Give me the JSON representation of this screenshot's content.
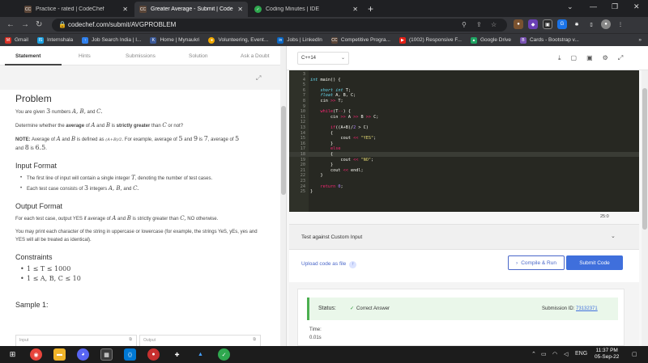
{
  "browser": {
    "tabs": [
      {
        "title": "Practice - rated | CodeChef",
        "icon": "codechef-icon",
        "color": "#5b4638"
      },
      {
        "title": "Greater Average - Submit | Code",
        "icon": "codechef-icon",
        "color": "#5b4638"
      },
      {
        "title": "Coding Minutes | IDE",
        "icon": "coding-minutes-icon",
        "color": "#2fa84f"
      }
    ],
    "url": "codechef.com/submit/AVGPROBLEM",
    "bookmarks": [
      "Gmail",
      "Internshala",
      "Job Search India | I...",
      "Home | Mynaukri",
      "Volunteering, Event...",
      "Jobs | LinkedIn",
      "Competitive Progra...",
      "(1002) Responsive F...",
      "Google Drive",
      "Cards - Bootstrap v..."
    ]
  },
  "problem_tabs": [
    "Statement",
    "Hints",
    "Submissions",
    "Solution",
    "Ask a Doubt"
  ],
  "problem": {
    "title": "Problem",
    "intro_a": "You are given ",
    "intro_math": "3",
    "intro_b": " numbers ",
    "intro_vars": "A, B,",
    "intro_c": " and ",
    "intro_cvar": "C.",
    "q_a": "Determine whether the ",
    "q_avg": "average",
    "q_b": " of ",
    "q_A": "A",
    "q_c": " and ",
    "q_B": "B",
    "q_d": " is ",
    "q_sg": "strictly greater",
    "q_e": " than ",
    "q_C": "C",
    "q_f": " or not?",
    "note_label": "NOTE:",
    "note_a": " Average of ",
    "note_A": "A",
    "note_b": " and ",
    "note_B": "B",
    "note_c": " is defined as ",
    "note_frac": "(A+B)/2",
    "note_d": ". For example, average of ",
    "note_5": "5",
    "note_e": " and ",
    "note_9": "9",
    "note_f": " is ",
    "note_7": "7",
    "note_g": ", average of ",
    "note_5b": "5",
    "note_h": "and ",
    "note_8": "8",
    "note_i": " is ",
    "note_65": "6.5",
    "note_j": ".",
    "input_heading": "Input Format",
    "input_1a": "The first line of input will contain a single integer ",
    "input_1T": "T",
    "input_1b": ", denoting the number of test cases.",
    "input_2a": "Each test case consists of ",
    "input_2n": "3",
    "input_2b": " integers ",
    "input_2v": "A, B,",
    "input_2c": " and ",
    "input_2C": "C.",
    "output_heading": "Output Format",
    "output_1a": "For each test case, output YES if average of ",
    "output_1A": "A",
    "output_1b": " and ",
    "output_1B": "B",
    "output_1c": " is strictly greater than ",
    "output_1C": "C,",
    "output_1d": " NO otherwise.",
    "output_2": "You may print each character of the string in uppercase or lowercase (for example, the strings YeS, yEs, yes and YES will all be treated as identical).",
    "constraints_heading": "Constraints",
    "constraints": [
      "1 ≤ T ≤ 1000",
      "1 ≤ A, B, C ≤ 10"
    ],
    "sample_heading": "Sample 1:",
    "sample_input": "Input",
    "sample_output": "Output"
  },
  "editor": {
    "language": "C++14",
    "lines": [
      {
        "n": "3",
        "t": ""
      },
      {
        "n": "4",
        "t": "int main() {"
      },
      {
        "n": "5",
        "t": ""
      },
      {
        "n": "6",
        "t": "    short int T;"
      },
      {
        "n": "7",
        "t": "    float A, B, C;"
      },
      {
        "n": "8",
        "t": "    cin >> T;"
      },
      {
        "n": "9",
        "t": ""
      },
      {
        "n": "10",
        "t": "    while(T--) {"
      },
      {
        "n": "11",
        "t": "        cin >> A >> B >> C;"
      },
      {
        "n": "12",
        "t": ""
      },
      {
        "n": "13",
        "t": "        if((A+B)/2 > C)"
      },
      {
        "n": "14",
        "t": "        {"
      },
      {
        "n": "15",
        "t": "            cout << \"YES\";"
      },
      {
        "n": "16",
        "t": "        }"
      },
      {
        "n": "17",
        "t": "        else"
      },
      {
        "n": "18",
        "t": "        {"
      },
      {
        "n": "19",
        "t": "            cout << \"NO\";"
      },
      {
        "n": "20",
        "t": "        }"
      },
      {
        "n": "21",
        "t": "        cout << endl;"
      },
      {
        "n": "22",
        "t": "    }"
      },
      {
        "n": "23",
        "t": ""
      },
      {
        "n": "24",
        "t": "    return 0;"
      },
      {
        "n": "25",
        "t": "}"
      }
    ],
    "char_count": "25:0"
  },
  "custom_input_label": "Test against Custom Input",
  "upload_label": "Upload code as file",
  "compile_run_label": "Compile & Run",
  "submit_label": "Submit Code",
  "result": {
    "status_label": "Status:",
    "status_value": "Correct Answer",
    "submission_label": "Submission ID:",
    "submission_id": "73132371",
    "time_label": "Time:",
    "time_value": "0.01s"
  },
  "taskbar": {
    "time": "11:37 PM",
    "date": "05-Sep-22",
    "lang": "ENG"
  }
}
